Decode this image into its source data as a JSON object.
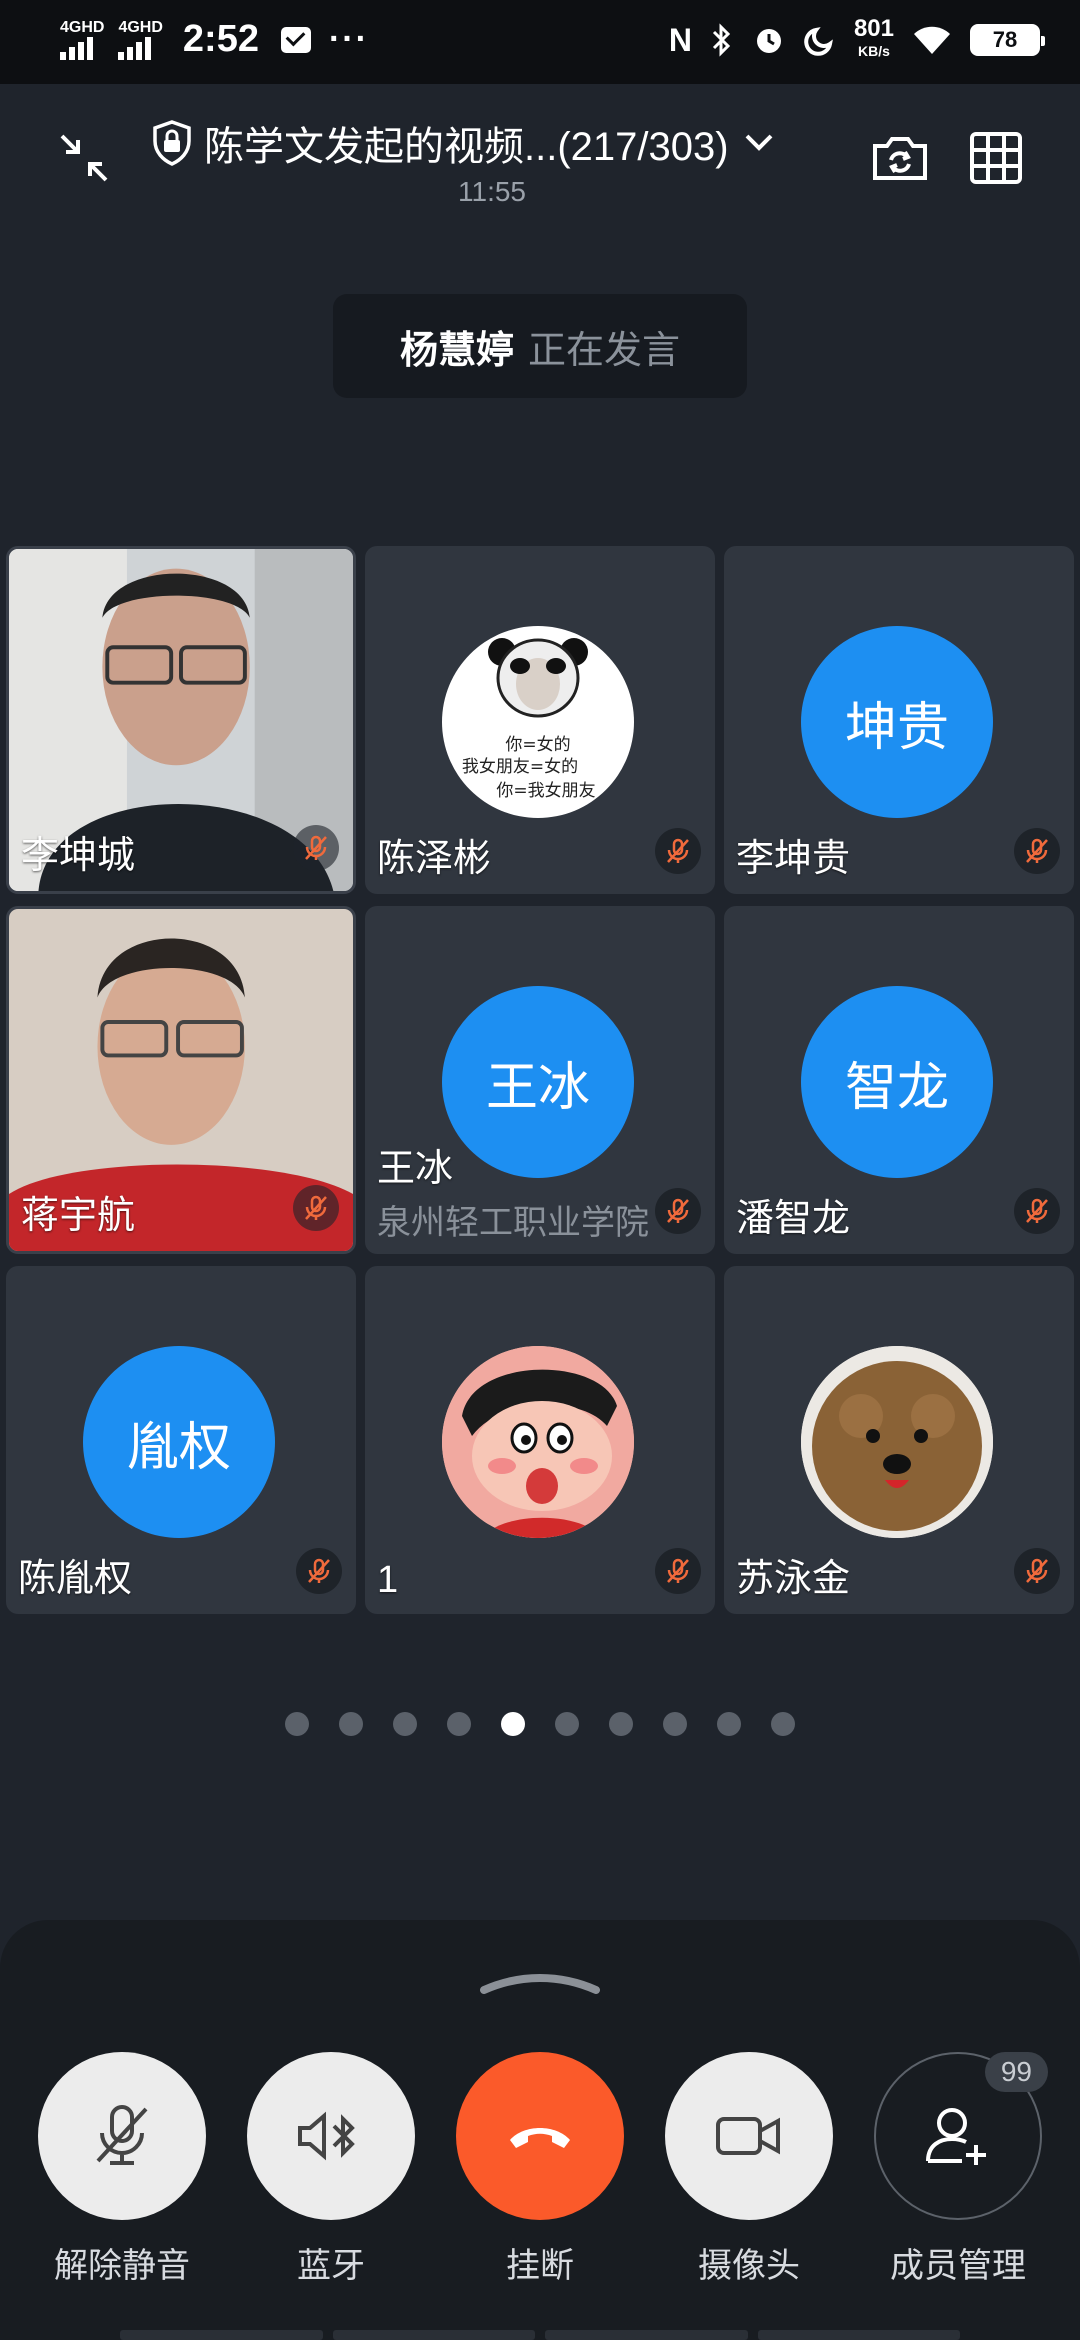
{
  "status_bar": {
    "sim1_label": "4GHD",
    "sim2_label": "4GHD",
    "time": "2:52",
    "more": "···",
    "nfc": "N",
    "speed_value": "801",
    "speed_unit": "KB/s",
    "battery": "78"
  },
  "header": {
    "title": "陈学文发起的视频...(217/303)",
    "duration": "11:55"
  },
  "speaking_banner": {
    "speaker": "杨慧婷",
    "status": "正在发言"
  },
  "participants": [
    {
      "name": "李坤城",
      "type": "video",
      "muted": true
    },
    {
      "name": "陈泽彬",
      "type": "image",
      "muted": true,
      "meme_lines": [
        "你=女的",
        "我女朋友=女的",
        "你=我女朋友"
      ]
    },
    {
      "name": "李坤贵",
      "type": "initials",
      "initials": "坤贵",
      "muted": true
    },
    {
      "name": "蒋宇航",
      "type": "video",
      "muted": true
    },
    {
      "name": "王冰",
      "type": "initials",
      "initials": "王冰",
      "org": "泉州轻工职业学院",
      "muted": true
    },
    {
      "name": "潘智龙",
      "type": "initials",
      "initials": "智龙",
      "muted": true
    },
    {
      "name": "陈胤权",
      "type": "initials",
      "initials": "胤权",
      "muted": true
    },
    {
      "name": "1",
      "type": "image",
      "muted": true
    },
    {
      "name": "苏泳金",
      "type": "image",
      "muted": true
    }
  ],
  "pager": {
    "total": 10,
    "active_index": 4
  },
  "controls": [
    {
      "label": "解除静音",
      "icon": "mic-off-icon"
    },
    {
      "label": "蓝牙",
      "icon": "bluetooth-speaker-icon"
    },
    {
      "label": "挂断",
      "icon": "hang-up-icon"
    },
    {
      "label": "摄像头",
      "icon": "camera-icon"
    },
    {
      "label": "成员管理",
      "icon": "add-member-icon",
      "badge": "99"
    }
  ],
  "colors": {
    "accent": "#1d8ff2",
    "hangup": "#fb5a2a",
    "background": "#1f242c"
  }
}
